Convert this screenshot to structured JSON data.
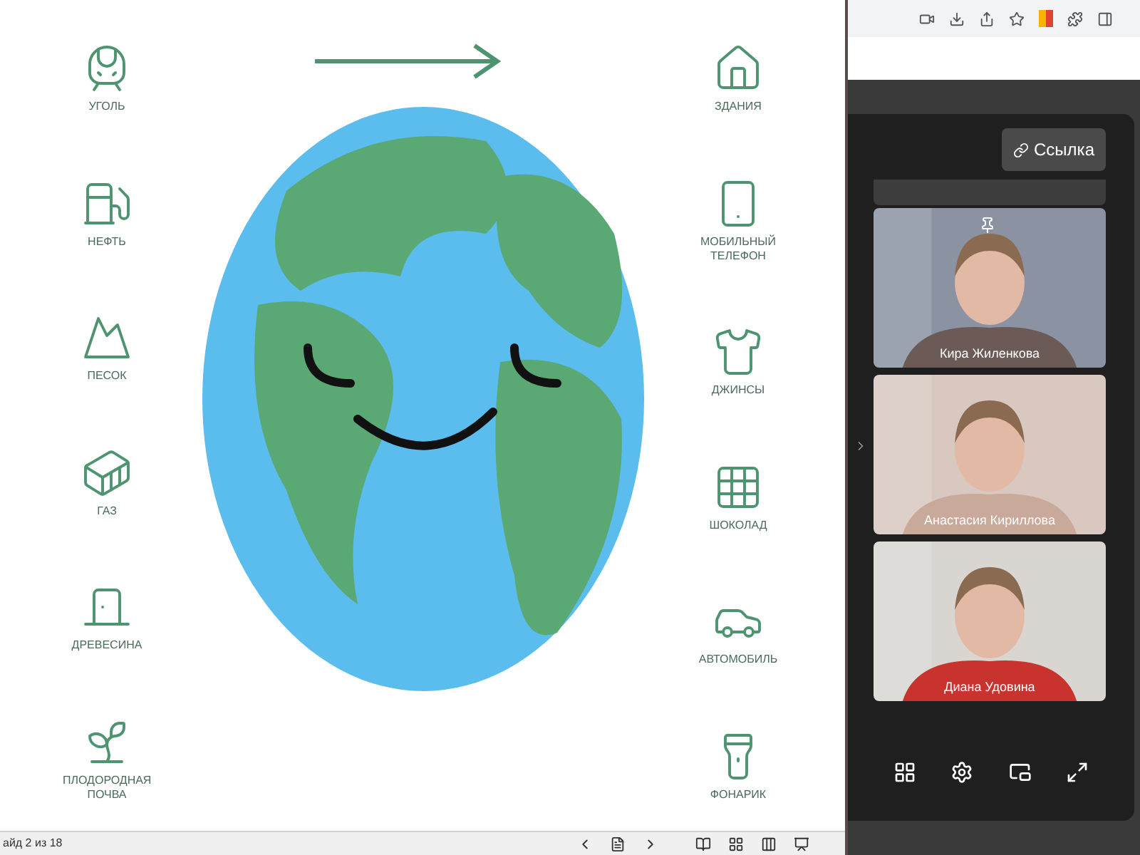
{
  "slide": {
    "left_items": [
      {
        "label": "УГОЛЬ"
      },
      {
        "label": "НЕФТЬ"
      },
      {
        "label": "ПЕСОК"
      },
      {
        "label": "ГАЗ"
      },
      {
        "label": "ДРЕВЕСИНА"
      },
      {
        "label": "ПЛОДОРОДНАЯ ПОЧВА"
      }
    ],
    "right_items": [
      {
        "label": "ЗДАНИЯ"
      },
      {
        "label": "МОБИЛЬНЫЙ ТЕЛЕФОН"
      },
      {
        "label": "ДЖИНСЫ"
      },
      {
        "label": "ШОКОЛАД"
      },
      {
        "label": "АВТОМОБИЛЬ"
      },
      {
        "label": "ФОНАРИК"
      }
    ]
  },
  "status_bar": {
    "slide_counter": "айд 2 из 18"
  },
  "call_panel": {
    "link_button": "Ссылка",
    "participants": [
      {
        "name": "Кира Жиленкова",
        "pinned": true
      },
      {
        "name": "Анастасия Кириллова",
        "pinned": false
      },
      {
        "name": "Диана Удовина",
        "pinned": false
      }
    ]
  }
}
